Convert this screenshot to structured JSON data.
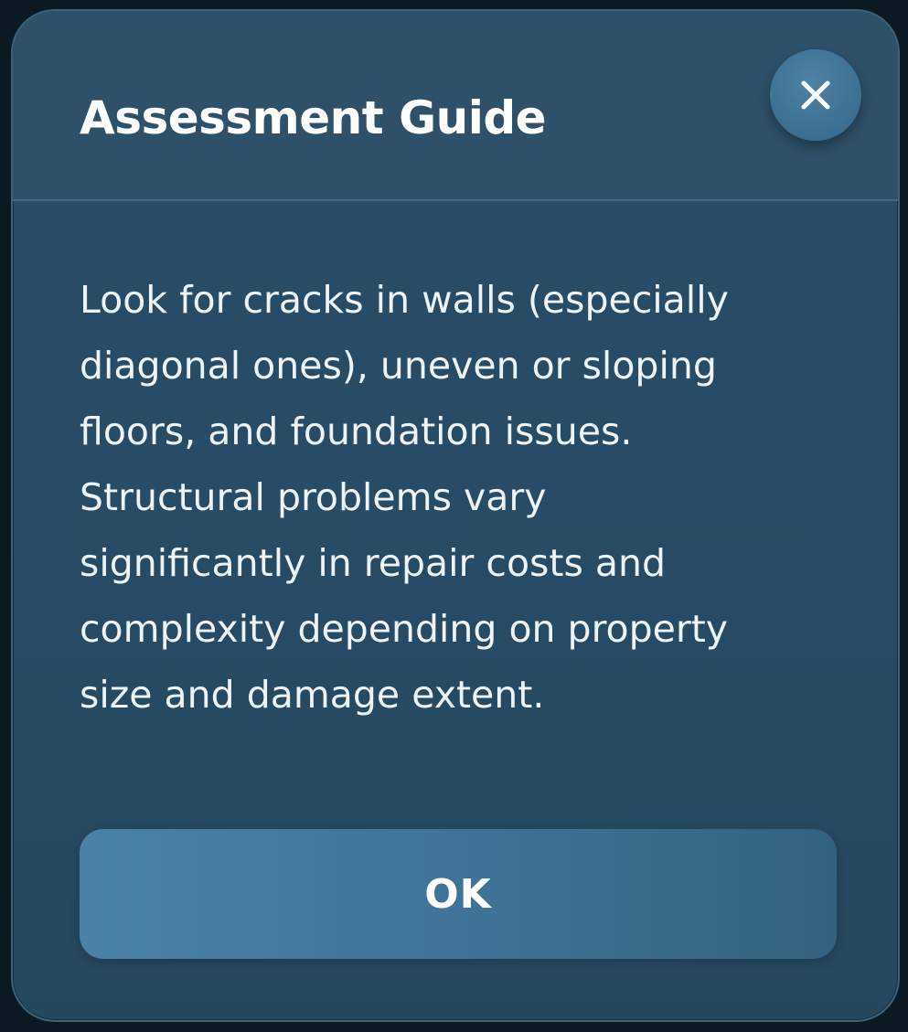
{
  "dialog": {
    "title": "Assessment Guide",
    "close_icon": "close-icon",
    "body_lines": [
      "Look for cracks in walls (especially",
      "diagonal ones), uneven or sloping",
      "floors, and foundation issues.",
      "Structural problems vary",
      "significantly in repair costs and",
      "complexity depending on property",
      "size and damage extent."
    ],
    "ok_label": "OK"
  },
  "colors": {
    "backdrop": "#0b1a22",
    "dialog_bg": "#274b64",
    "header_bg": "#2e5169",
    "button_accent": "#4a82a6",
    "text": "#ffffff"
  }
}
